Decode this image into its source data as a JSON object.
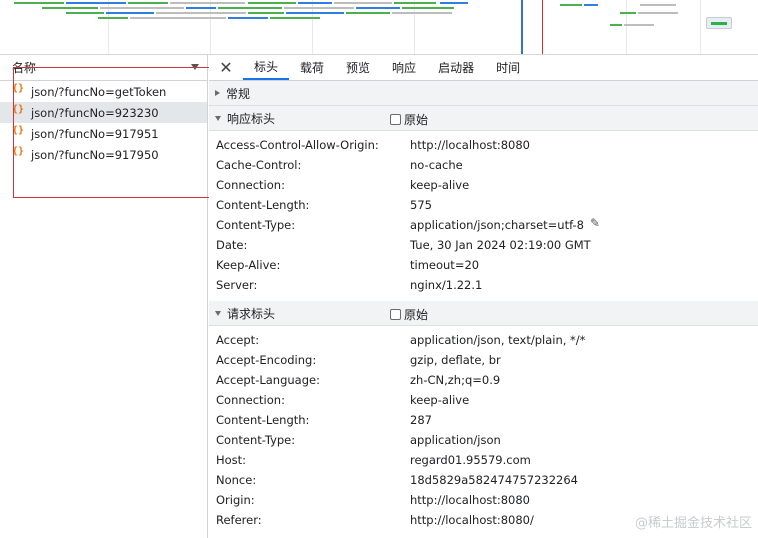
{
  "request_list": {
    "header": "名称",
    "items": [
      {
        "name": "json/?funcNo=getToken"
      },
      {
        "name": "json/?funcNo=923230"
      },
      {
        "name": "json/?funcNo=917951"
      },
      {
        "name": "json/?funcNo=917950"
      }
    ],
    "selected_index": 1
  },
  "tabs": [
    "标头",
    "载荷",
    "预览",
    "响应",
    "启动器",
    "时间"
  ],
  "active_tab": "标头",
  "sections": {
    "general": {
      "title": "常规"
    },
    "response_headers": {
      "title": "响应标头",
      "raw_label": "原始",
      "rows": [
        {
          "key": "Access-Control-Allow-Origin:",
          "value": "http://localhost:8080"
        },
        {
          "key": "Cache-Control:",
          "value": "no-cache"
        },
        {
          "key": "Connection:",
          "value": "keep-alive"
        },
        {
          "key": "Content-Length:",
          "value": "575"
        },
        {
          "key": "Content-Type:",
          "value": "application/json;charset=utf-8"
        },
        {
          "key": "Date:",
          "value": "Tue, 30 Jan 2024 02:19:00 GMT"
        },
        {
          "key": "Keep-Alive:",
          "value": "timeout=20"
        },
        {
          "key": "Server:",
          "value": "nginx/1.22.1"
        }
      ]
    },
    "request_headers": {
      "title": "请求标头",
      "raw_label": "原始",
      "rows": [
        {
          "key": "Accept:",
          "value": "application/json, text/plain, */*"
        },
        {
          "key": "Accept-Encoding:",
          "value": "gzip, deflate, br"
        },
        {
          "key": "Accept-Language:",
          "value": "zh-CN,zh;q=0.9"
        },
        {
          "key": "Connection:",
          "value": "keep-alive"
        },
        {
          "key": "Content-Length:",
          "value": "287"
        },
        {
          "key": "Content-Type:",
          "value": "application/json"
        },
        {
          "key": "Host:",
          "value": "regard01.95579.com"
        },
        {
          "key": "Nonce:",
          "value": "18d5829a582474757232264"
        },
        {
          "key": "Origin:",
          "value": "http://localhost:8080"
        },
        {
          "key": "Referer:",
          "value": "http://localhost:8080/"
        }
      ]
    }
  },
  "watermark": "@稀土掘金技术社区",
  "colors": {
    "active_tab_underline": "#1a73e8",
    "highlight_box": "#d0343b",
    "request_icon": "#e8710a"
  }
}
